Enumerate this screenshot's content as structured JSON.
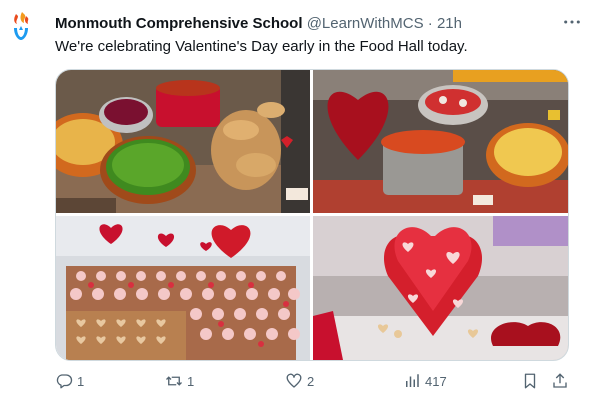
{
  "tweet": {
    "author_name": "Monmouth Comprehensive School",
    "handle": "@LearnWithMCS",
    "separator": "·",
    "time": "21h",
    "text": "We're celebrating Valentine's Day early in the Food Hall today.",
    "more_icon": "more-dots-icon"
  },
  "actions": {
    "replies": "1",
    "retweets": "1",
    "likes": "2",
    "views": "417"
  },
  "colors": {
    "text_primary": "#0f1419",
    "text_secondary": "#536471",
    "border": "#cfd9de"
  }
}
